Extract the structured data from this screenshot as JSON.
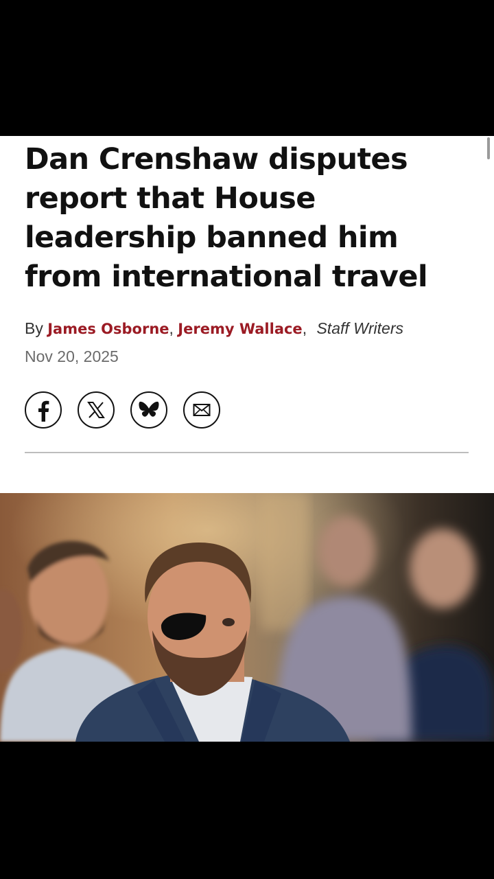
{
  "article": {
    "headline": "Dan Crenshaw disputes report that House leadership banned him from international travel",
    "byline_prefix": "By",
    "authors": [
      "James Osborne",
      "Jeremy Wallace"
    ],
    "separator": ",",
    "author_role": "Staff Writers",
    "date": "Nov 20, 2025"
  },
  "share": {
    "icons": [
      "facebook-icon",
      "x-icon",
      "bluesky-icon",
      "email-icon"
    ]
  },
  "colors": {
    "author_link": "#9b1b24",
    "headline": "#111111",
    "date": "#6b6b6b"
  }
}
